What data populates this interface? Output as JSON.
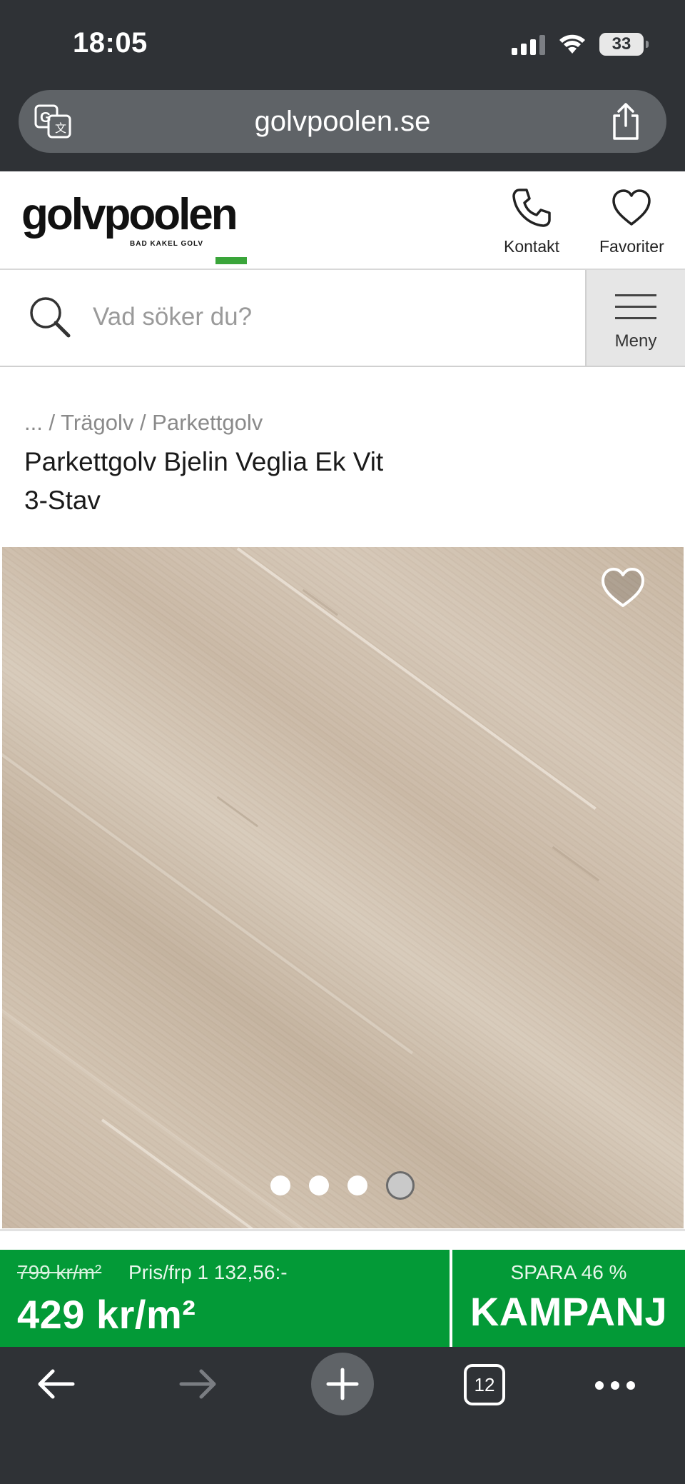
{
  "status_bar": {
    "time": "18:05",
    "battery": "33"
  },
  "browser": {
    "url": "golvpoolen.se",
    "open_tabs": "12"
  },
  "site": {
    "logo_text": "golvpoolen",
    "logo_tagline": "BAD KAKEL GOLV",
    "contact_label": "Kontakt",
    "favorites_label": "Favoriter"
  },
  "search": {
    "placeholder": "Vad söker du?",
    "menu_label": "Meny"
  },
  "breadcrumb": "... / Trägolv / Parkettgolv",
  "product": {
    "title": "Parkettgolv Bjelin Veglia Ek Vit 3-Stav",
    "image_count": 4,
    "active_image": 4
  },
  "price": {
    "old_price": "799 kr/m²",
    "unit_price": "Pris/frp 1 132,56:-",
    "new_price": "429 kr/m²",
    "save_text": "SPARA 46 %",
    "campaign_label": "KAMPANJ"
  },
  "colors": {
    "brand_green": "#039a37",
    "browser_chrome": "#2f3236"
  },
  "icons": [
    "translate-icon",
    "share-icon",
    "phone-icon",
    "heart-icon",
    "search-icon",
    "menu-icon",
    "back-arrow-icon",
    "forward-arrow-icon",
    "plus-icon",
    "tabs-icon",
    "more-icon"
  ]
}
